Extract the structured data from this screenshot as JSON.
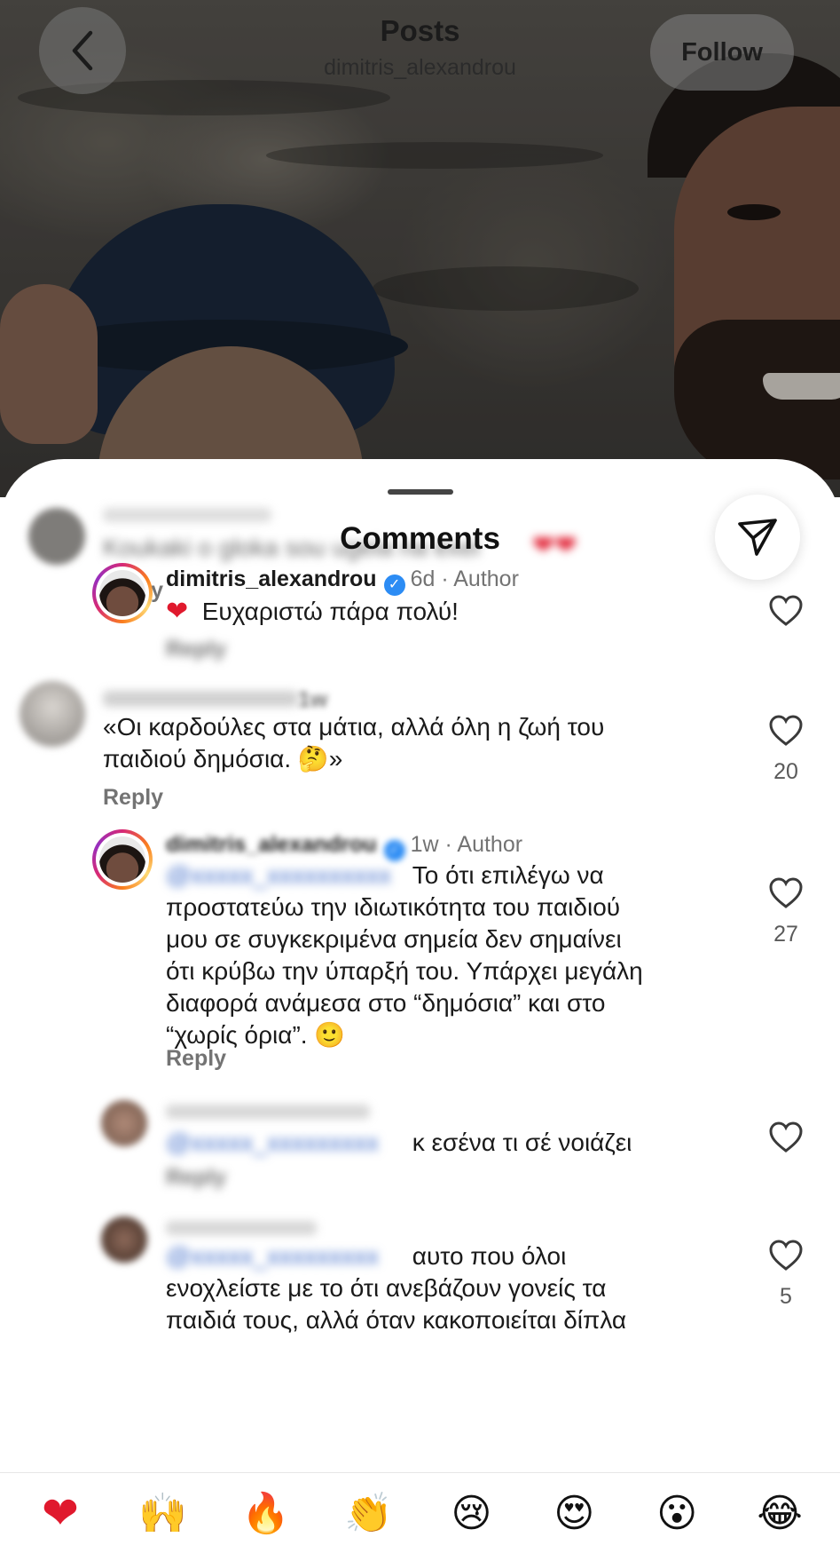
{
  "header": {
    "title": "Posts",
    "subtitle": "dimitris_alexandrou",
    "follow_label": "Follow"
  },
  "sheet": {
    "title": "Comments"
  },
  "comments": [
    {
      "username": "",
      "text": "Koukaki o gloka sou ugeia na exei",
      "reply_label": "Reply",
      "blurred": true
    },
    {
      "username": "dimitris_alexandrou",
      "verified": true,
      "time": "6d",
      "role": "Author",
      "text": "Ευχαριστώ πάρα πολύ!",
      "reply_label": "Reply"
    },
    {
      "username": "",
      "time": "1w",
      "text_line1": "«Οι καρδούλες στα μάτια, αλλά όλη η ζωή του",
      "text_line2": "παιδιού δημόσια.",
      "text_end": "»",
      "reply_label": "Reply",
      "likes": "20"
    },
    {
      "username": "dimitris_alexandrou",
      "verified": true,
      "time": "1w",
      "role": "Author",
      "text_line1": "Το ότι επιλέγω να",
      "text_line2": "προστατεύω την ιδιωτικότητα του παιδιού",
      "text_line3": "μου σε συγκεκριμένα σημεία δεν σημαίνει",
      "text_line4": "ότι κρύβω την ύπαρξή του. Υπάρχει μεγάλη",
      "text_line5": "διαφορά ανάμεσα στο “δημόσια” και στο",
      "text_line6": "“χωρίς όρια”.",
      "reply_label": "Reply",
      "likes": "27"
    },
    {
      "username": "",
      "text": "κ εσένα τι σέ νοιάζει",
      "reply_label": "Reply"
    },
    {
      "username": "",
      "text_line1": "αυτο που όλοι",
      "text_line2": "ενοχλείστε με το ότι ανεβάζουν γονείς τα",
      "text_line3": "παιδιά τους, αλλά όταν κακοποιείται δίπλα",
      "likes": "5"
    }
  ],
  "emoji_bar": [
    "heart",
    "raising-hands",
    "fire",
    "clapping-hands",
    "crying-face",
    "heart-eyes",
    "surprised-face",
    "tears-of-joy"
  ]
}
